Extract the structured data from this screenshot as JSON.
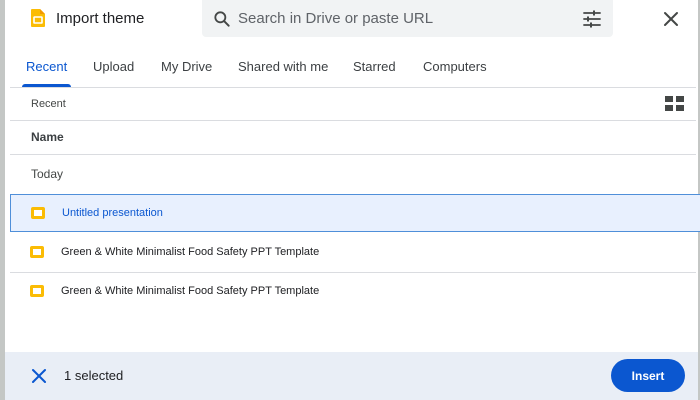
{
  "dialog": {
    "title": "Import theme",
    "close_icon": "close-icon",
    "logo_icon": "slides-logo-icon"
  },
  "search": {
    "placeholder": "Search in Drive or paste URL",
    "value": ""
  },
  "tabs": [
    {
      "label": "Recent",
      "active": true
    },
    {
      "label": "Upload",
      "active": false
    },
    {
      "label": "My Drive",
      "active": false
    },
    {
      "label": "Shared with me",
      "active": false
    },
    {
      "label": "Starred",
      "active": false
    },
    {
      "label": "Computers",
      "active": false
    }
  ],
  "breadcrumb": "Recent",
  "list": {
    "column_header": "Name",
    "group_label": "Today",
    "files": [
      {
        "name": "Untitled presentation",
        "selected": true
      },
      {
        "name": "Green & White Minimalist Food Safety PPT Template",
        "selected": false
      },
      {
        "name": "Green & White Minimalist Food Safety PPT Template",
        "selected": false
      }
    ]
  },
  "footer": {
    "selected_text": "1 selected",
    "insert_label": "Insert"
  },
  "colors": {
    "accent": "#0b57d0",
    "slides_yellow": "#fbbc04",
    "selected_bg": "#e8f0fe",
    "footer_bg": "#e9eef6"
  }
}
